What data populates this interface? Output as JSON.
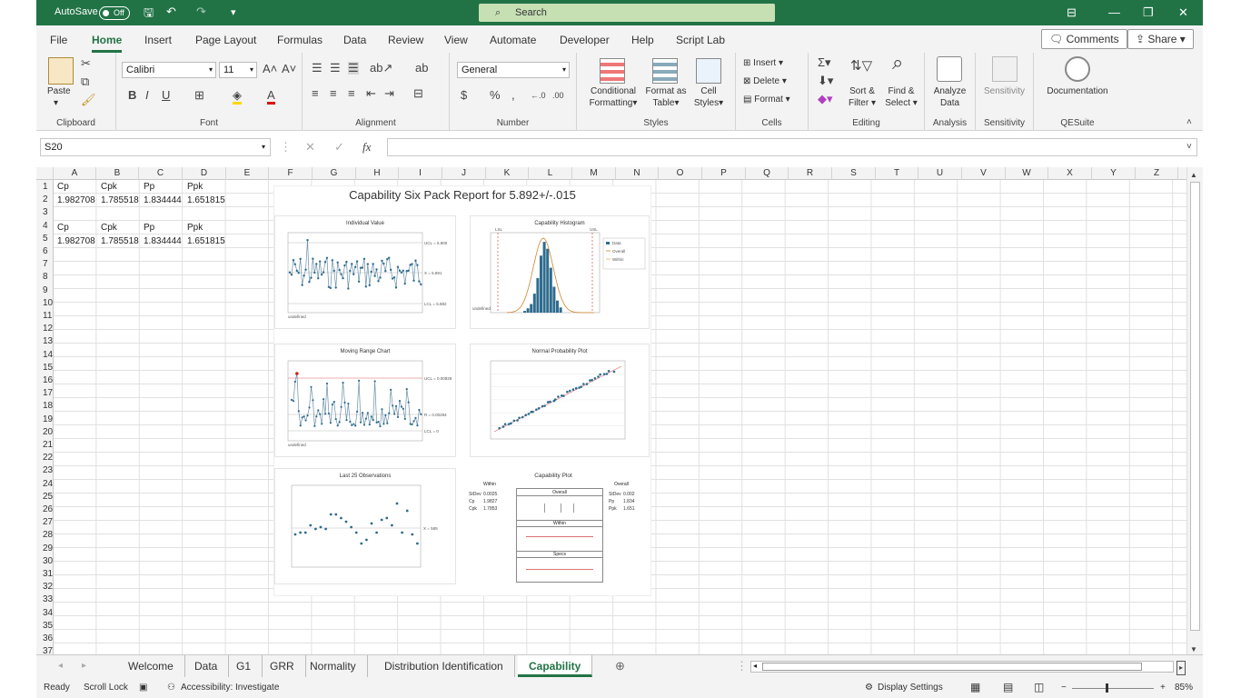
{
  "titlebar": {
    "autosave": "AutoSave",
    "toggle": "Off",
    "search": "Search"
  },
  "menu": {
    "items": [
      "File",
      "Home",
      "Insert",
      "Page Layout",
      "Formulas",
      "Data",
      "Review",
      "View",
      "Automate",
      "Developer",
      "Help",
      "Script Lab"
    ],
    "comments": "Comments",
    "share": "Share"
  },
  "ribbon": {
    "paste": "Paste",
    "font_name": "Calibri",
    "font_size": "11",
    "number_format": "General",
    "cond_format": [
      "Conditional",
      "Formatting"
    ],
    "format_table": [
      "Format as",
      "Table"
    ],
    "cell_styles": [
      "Cell",
      "Styles"
    ],
    "insert": "Insert",
    "delete": "Delete",
    "format": "Format",
    "sort_filter": [
      "Sort &",
      "Filter"
    ],
    "find_select": [
      "Find &",
      "Select"
    ],
    "analyze": [
      "Analyze",
      "Data"
    ],
    "sensitivity": "Sensitivity",
    "documentation": "Documentation",
    "groups": [
      "Clipboard",
      "Font",
      "Alignment",
      "Number",
      "Styles",
      "Cells",
      "Editing",
      "Analysis",
      "Sensitivity",
      "QESuite"
    ]
  },
  "formula": {
    "namebox": "S20",
    "value": ""
  },
  "columns": [
    "A",
    "B",
    "C",
    "D",
    "E",
    "F",
    "G",
    "H",
    "I",
    "J",
    "K",
    "L",
    "M",
    "N",
    "O",
    "P",
    "Q",
    "R",
    "S",
    "T",
    "U",
    "V",
    "W",
    "X",
    "Y",
    "Z"
  ],
  "rows": [
    "1",
    "2",
    "3",
    "4",
    "5",
    "6",
    "7",
    "8",
    "9",
    "10",
    "11",
    "12",
    "13",
    "14",
    "15",
    "16",
    "17",
    "18",
    "19",
    "20",
    "21",
    "22",
    "23",
    "24",
    "25",
    "26",
    "27",
    "28",
    "29",
    "30",
    "31",
    "32",
    "33",
    "34",
    "35",
    "36",
    "37"
  ],
  "cells": {
    "r1": [
      "Cp",
      "Cpk",
      "Pp",
      "Ppk"
    ],
    "r2": [
      "1.982708",
      "1.785518",
      "1.834444",
      "1.651815"
    ],
    "r4": [
      "Cp",
      "Cpk",
      "Pp",
      "Ppk"
    ],
    "r5": [
      "1.982708",
      "1.785518",
      "1.834444",
      "1.651815"
    ]
  },
  "report": {
    "title": "Capability Six Pack Report for 5.892+/-.015",
    "individual": {
      "title": "Individual Value",
      "ucl": "UCL = 5.900",
      "mean": "X = 5.891",
      "lcl": "LCL = 5.882",
      "xfirst": "undefined"
    },
    "histogram": {
      "title": "Capability Histogram",
      "lsl": "LSL",
      "usl": "USL",
      "legend": [
        "Data",
        "Overall",
        "Within"
      ],
      "xfirst": "undefined"
    },
    "moving": {
      "title": "Moving Range Chart",
      "ucl": "UCL = 0.00928",
      "mean": "R = 0.00284",
      "lcl": "LCL = 0",
      "xfirst": "undefined"
    },
    "normal": {
      "title": "Normal Probability Plot"
    },
    "last25": {
      "title": "Last 25 Observations",
      "mean": "X = 589"
    },
    "capplot": {
      "title": "Capability Plot",
      "within": "Within",
      "overall": "Overall",
      "specs": "Specs",
      "within_stats": [
        [
          "StDev",
          "0.0025"
        ],
        [
          "Cp",
          "1.9827"
        ],
        [
          "Cpk",
          "1.7853"
        ]
      ],
      "overall_stats": [
        [
          "StDev",
          "0.002"
        ],
        [
          "Pp",
          "1.834"
        ],
        [
          "Ppk",
          "1.651"
        ]
      ]
    }
  },
  "sheets": [
    "Welcome",
    "Data",
    "G1",
    "GRR",
    "Normality",
    "Distribution Identification",
    "Capability"
  ],
  "active_sheet": "Capability",
  "status": {
    "ready": "Ready",
    "scroll_lock": "Scroll Lock",
    "accessibility": "Accessibility: Investigate",
    "display": "Display Settings",
    "zoom": "85%"
  }
}
